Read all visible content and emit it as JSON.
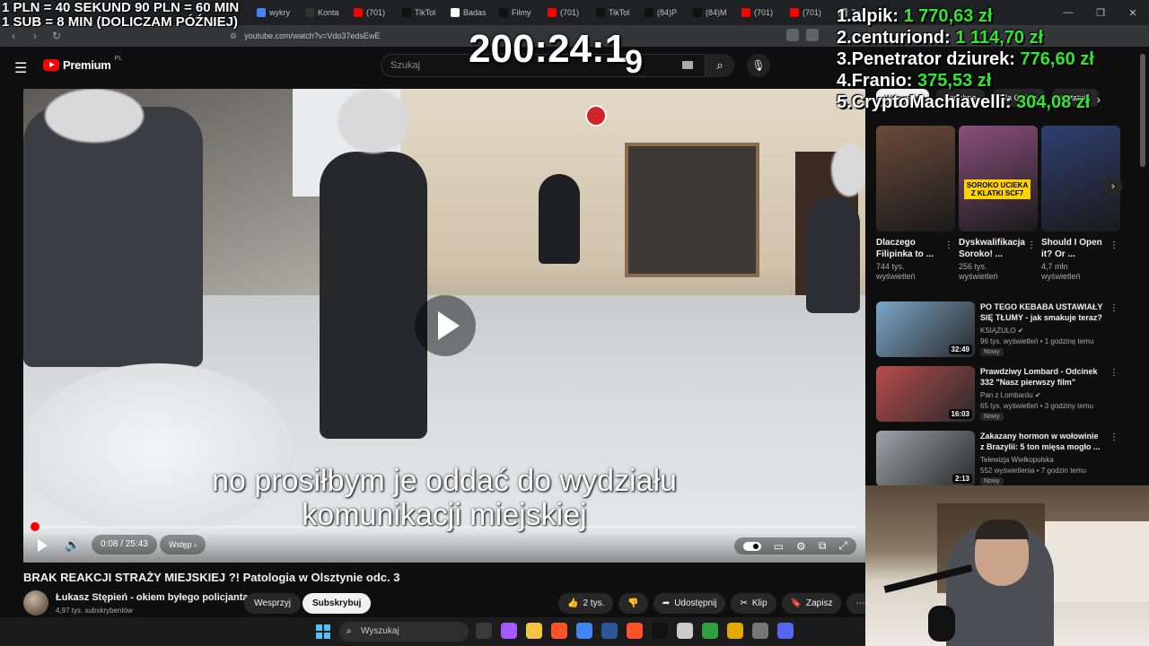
{
  "overlay": {
    "rules_line1": "1 PLN =  40 SEKUND 90 PLN = 60 MIN",
    "rules_line2": "1 SUB = 8 MIN (DOLICZAM PÓŹNIEJ)",
    "timer": "200:24:1",
    "timer_next_digit": "9",
    "leaderboard": [
      {
        "rank_name": "1.alpik:",
        "amount": "1 770,63 zł"
      },
      {
        "rank_name": "2.centuriond:",
        "amount": "1 114,70 zł"
      },
      {
        "rank_name": "3.Penetrator dziurek:",
        "amount": "776,60 zł"
      },
      {
        "rank_name": "4.Franio:",
        "amount": "375,53 zł"
      },
      {
        "rank_name": "5.CryptoMachiavelli:",
        "amount": "304,08 zł"
      }
    ]
  },
  "browser": {
    "tabs": [
      {
        "label": "wykry",
        "color": "#4285f4"
      },
      {
        "label": "Konta",
        "color": "#333333"
      },
      {
        "label": "(701)",
        "color": "#ff0000"
      },
      {
        "label": "TikTol",
        "color": "#111111"
      },
      {
        "label": "Badas",
        "color": "#ffffff"
      },
      {
        "label": "Filmy",
        "color": "#111111"
      },
      {
        "label": "(701)",
        "color": "#ff0000"
      },
      {
        "label": "TikTol",
        "color": "#111111"
      },
      {
        "label": "(84)P",
        "color": "#111111"
      },
      {
        "label": "(84)M",
        "color": "#111111"
      },
      {
        "label": "(701)",
        "color": "#ff0000"
      },
      {
        "label": "(701)",
        "color": "#ff0000"
      },
      {
        "label": "Trust",
        "color": "#888888"
      }
    ],
    "url": "youtube.com/watch?v=Vdo37edsEwE"
  },
  "youtube": {
    "logo_text": "Premium",
    "logo_region": "PL",
    "search_placeholder": "Szukaj"
  },
  "player": {
    "subtitle_line1": "no prosiłbym je oddać do wydziału",
    "subtitle_line2": "komunikacji miejskiej",
    "time": "0:08 / 25:43",
    "chapter": "Wstęp",
    "progress_fraction": 0.005
  },
  "video": {
    "title": "BRAK REAKCJI STRAŻY MIEJSKIEJ ?! Patologia w Olsztynie odc. 3",
    "channel": "Łukasz Stępień - okiem byłego policjanta",
    "subscribers": "4,97 tys. subskrybentów",
    "support_label": "Wesprzyj",
    "subscribe_label": "Subskrybuj",
    "likes": "2 tys.",
    "share_label": "Udostępnij",
    "clip_label": "Klip",
    "save_label": "Zapisz"
  },
  "sidebar": {
    "chips": [
      "Wszystkie",
      "Podobne",
      "Dla Ciebie",
      "Ostatnio"
    ],
    "shorts": [
      {
        "title": "Dlaczego Filipinka to ...",
        "views": "744 tys. wyświetleń",
        "color": "#6b4a3a",
        "badge": ""
      },
      {
        "title": "Dyskwalifikacja Soroko! ...",
        "views": "256 tys. wyświetleń",
        "color": "#8a4f7a",
        "badge": "SOROKO UCIEKA Z KLATKI SCF7"
      },
      {
        "title": "Should I Open it? Or ...",
        "views": "4,7 mln wyświetleń",
        "color": "#2f3f70",
        "badge": ""
      }
    ],
    "recommended": [
      {
        "title": "PO TEGO KEBABA USTAWIAŁY SIĘ TŁUMY - jak smakuje teraz?",
        "channel": "KSIĄŻULO",
        "meta": "96 tys. wyświetleń • 1 godzinę temu",
        "badge": "Nowy",
        "duration": "32:49",
        "color": "#7aa6c9"
      },
      {
        "title": "Prawdziwy Lombard - Odcinek 332 \"Nasz pierwszy film\"",
        "channel": "Pan z Lombardu",
        "meta": "65 tys. wyświetleń • 3 godziny temu",
        "badge": "Nowy",
        "duration": "16:03",
        "color": "#b84b4b"
      },
      {
        "title": "Zakazany hormon w wołowinie z Brazylii: 5 ton mięsa mogło ...",
        "channel": "Telewizja Wielkopolska",
        "meta": "552 wyświetlenia • 7 godzin temu",
        "badge": "Nowy",
        "duration": "2:13",
        "color": "#9aa4a8"
      }
    ]
  },
  "taskbar": {
    "search_placeholder": "Wyszukaj",
    "icons": [
      "#3a3a3a",
      "#a259ff",
      "#f4c542",
      "#fb542b",
      "#4285f4",
      "#2b579a",
      "#fb542b",
      "#111111",
      "#cccccc",
      "#2ea043",
      "#e0a800",
      "#777777",
      "#5865f2",
      "#171a21"
    ]
  }
}
